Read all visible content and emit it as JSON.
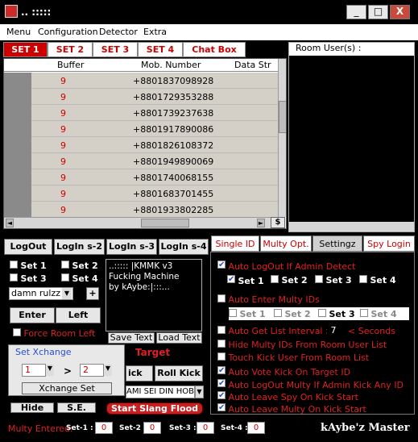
{
  "window": {
    "title": ".. :::::"
  },
  "menu": [
    "Menu",
    "Configuration",
    "Detector",
    "Extra"
  ],
  "top_tabs": [
    "SET 1",
    "SET 2",
    "SET 3",
    "SET 4",
    "Chat Box"
  ],
  "grid": {
    "columns": [
      "Buffer",
      "Mob. Number",
      "Data Str"
    ],
    "rows": [
      {
        "buffer": "9",
        "number": "+8801837098928"
      },
      {
        "buffer": "9",
        "number": "+8801729353288"
      },
      {
        "buffer": "9",
        "number": "+8801739237638"
      },
      {
        "buffer": "9",
        "number": "+8801917890086"
      },
      {
        "buffer": "9",
        "number": "+8801826108372"
      },
      {
        "buffer": "9",
        "number": "+8801949890069"
      },
      {
        "buffer": "9",
        "number": "+8801740068155"
      },
      {
        "buffer": "9",
        "number": "+8801683701455"
      },
      {
        "buffer": "9",
        "number": "+8801933802285"
      }
    ],
    "scroll_btn": "$"
  },
  "room_panel": {
    "title": "Room User(s) :"
  },
  "login_buttons": [
    "LogOut",
    "LogIn s-2",
    "LogIn s-3",
    "LogIn s-4"
  ],
  "sets_checks": [
    {
      "label": "Set 1",
      "checked": false
    },
    {
      "label": "Set 2",
      "checked": false
    },
    {
      "label": "Set 3",
      "checked": false
    },
    {
      "label": "Set 4",
      "checked": false
    }
  ],
  "name_select": "damn rulzz",
  "plus_label": "+",
  "enter_label": "Enter",
  "left_label": "Left",
  "force_room_left": "Force Room Left",
  "message_text": "..::::: |KMMK v3\nFucking Machine\nby  kAybe:|:::...",
  "save_text": "Save Text",
  "load_text": "Load Text",
  "set_xchange": {
    "title": "Set Xchange",
    "from": "1",
    "arrow": ">",
    "to": "2",
    "button": "Xchange Set"
  },
  "target_label": "Target",
  "kick_label": "ick",
  "roll_kick": "Roll Kick",
  "slang_text": "AMI SEI DIN HOB",
  "hide_label": "Hide",
  "se_label": "S.E.",
  "start_slang": "Start Slang Flood",
  "right_tabs": [
    "Single ID",
    "Multy Opt.",
    "Settingz",
    "Spy Login"
  ],
  "settings": {
    "auto_logout_admin": {
      "label": "Auto LogOut If Admin Detect",
      "checked": true
    },
    "logout_sets": [
      {
        "label": "Set 1",
        "checked": true
      },
      {
        "label": "Set 2",
        "checked": false
      },
      {
        "label": "Set 3",
        "checked": false
      },
      {
        "label": "Set 4",
        "checked": false
      }
    ],
    "auto_enter_multy": {
      "label": "Auto Enter Multy IDs",
      "checked": false
    },
    "enter_sets": [
      {
        "label": "Set 1",
        "checked": false
      },
      {
        "label": "Set 2",
        "checked": false
      },
      {
        "label": "Set 3",
        "checked": false
      },
      {
        "label": "Set 4",
        "checked": false
      }
    ],
    "auto_get_list": {
      "label": "Auto Get List Interval >",
      "checked": false,
      "value": "7",
      "unit": "< Seconds"
    },
    "hide_multy": {
      "label": "Hide Multy IDs From Room User List",
      "checked": false
    },
    "touch_kick": {
      "label": "Touch Kick User From Room List",
      "checked": false
    },
    "auto_vote_kick": {
      "label": "Auto Vote Kick On Target ID",
      "checked": true
    },
    "auto_logout_multy": {
      "label": "Auto LogOut Multy If Admin Kick Any ID",
      "checked": true
    },
    "auto_leave_spy": {
      "label": "Auto Leave Spy On Kick Start",
      "checked": true
    },
    "auto_leave_multy": {
      "label": "Auto Leave Multy On Kick Start",
      "checked": true
    }
  },
  "bottom": {
    "multy_entered": "Multy Entered:",
    "sets": [
      {
        "label": "Set-1 :",
        "value": "0"
      },
      {
        "label": "Set-2 :",
        "value": "0"
      },
      {
        "label": "Set-3 :",
        "value": "0"
      },
      {
        "label": "Set-4 :",
        "value": "0"
      }
    ],
    "brand": "kAybe'z Master"
  }
}
